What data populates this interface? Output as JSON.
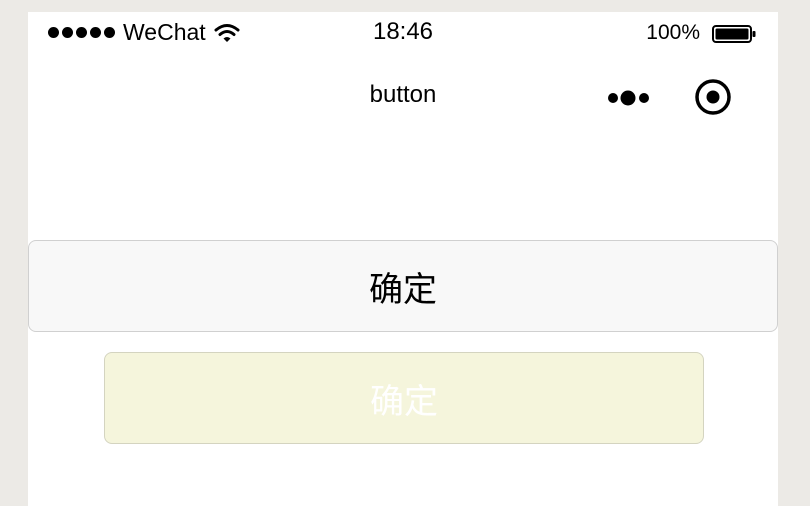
{
  "status_bar": {
    "carrier": "WeChat",
    "time": "18:46",
    "battery_percent": "100%",
    "battery_level": 1.0,
    "signal_icon": "signal-dots-icon",
    "wifi_icon": "wifi-icon",
    "battery_icon": "battery-icon"
  },
  "nav_bar": {
    "title": "button",
    "more_icon": "more-icon",
    "close_icon": "close-icon"
  },
  "buttons": [
    {
      "label": "确定",
      "style": "default",
      "background": "#f8f8f8",
      "text_color": "#000000"
    },
    {
      "label": "确定",
      "style": "mini-disabled",
      "background": "#f5f5dc",
      "text_color": "#ffffff"
    }
  ]
}
